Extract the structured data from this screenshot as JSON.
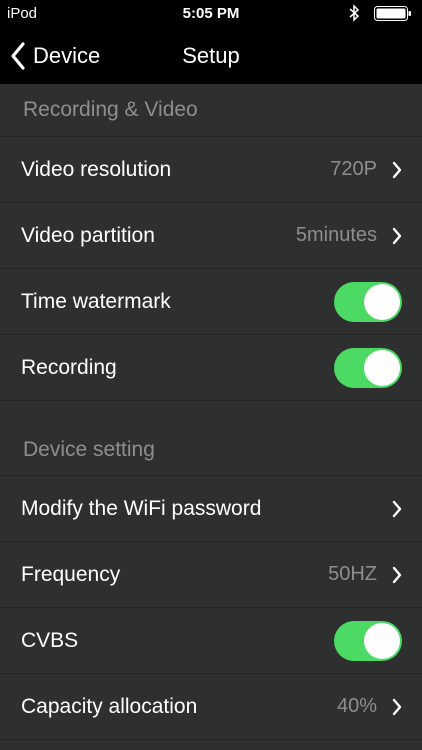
{
  "status_bar": {
    "carrier": "iPod",
    "time": "5:05 PM",
    "bluetooth_icon": "bluetooth-icon",
    "battery_icon": "battery-icon"
  },
  "nav": {
    "back_label": "Device",
    "title": "Setup"
  },
  "sections": [
    {
      "header": "Recording & Video",
      "rows": [
        {
          "label": "Video resolution",
          "value": "720P",
          "type": "disclosure"
        },
        {
          "label": "Video partition",
          "value": "5minutes",
          "type": "disclosure"
        },
        {
          "label": "Time watermark",
          "type": "toggle",
          "on": true
        },
        {
          "label": "Recording",
          "type": "toggle",
          "on": true
        }
      ]
    },
    {
      "header": "Device setting",
      "rows": [
        {
          "label": "Modify the WiFi password",
          "type": "disclosure"
        },
        {
          "label": "Frequency",
          "value": "50HZ",
          "type": "disclosure"
        },
        {
          "label": "CVBS",
          "type": "toggle",
          "on": true
        },
        {
          "label": "Capacity allocation",
          "value": "40%",
          "type": "disclosure"
        }
      ]
    }
  ],
  "colors": {
    "toggle_on": "#4cd964",
    "background": "#2e3030",
    "secondary_text": "#8c8f8f"
  }
}
